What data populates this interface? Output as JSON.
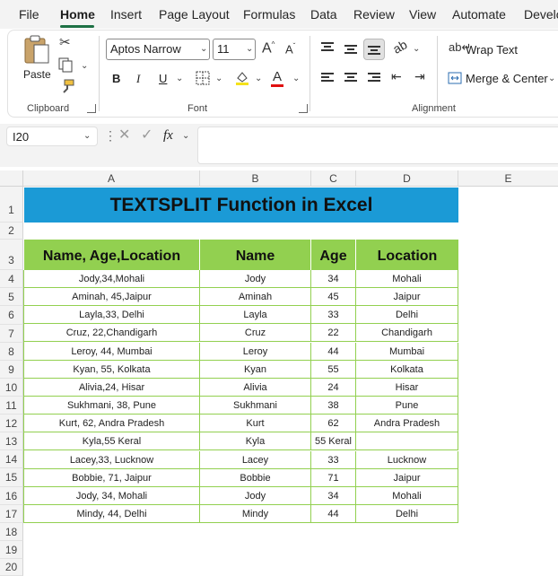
{
  "tabs": [
    "File",
    "Home",
    "Insert",
    "Page Layout",
    "Formulas",
    "Data",
    "Review",
    "View",
    "Automate",
    "Develo"
  ],
  "ribbon": {
    "clipboard": {
      "paste_label": "Paste",
      "group_label": "Clipboard"
    },
    "font": {
      "font_name": "Aptos Narrow",
      "font_size": "11",
      "bold": "B",
      "italic": "I",
      "underline": "U",
      "group_label": "Font"
    },
    "alignment": {
      "wrap_text": "Wrap Text",
      "merge_center": "Merge & Center",
      "group_label": "Alignment"
    }
  },
  "formula_bar": {
    "name_box": "I20",
    "fx": "fx",
    "content": ""
  },
  "columns": [
    "A",
    "B",
    "C",
    "D",
    "E"
  ],
  "rows": [
    "1",
    "2",
    "3",
    "4",
    "5",
    "6",
    "7",
    "8",
    "9",
    "10",
    "11",
    "12",
    "13",
    "14",
    "15",
    "16",
    "17",
    "18",
    "19",
    "20"
  ],
  "sheet": {
    "title": "TEXTSPLIT Function in Excel",
    "headers": [
      "Name, Age,Location",
      "Name",
      "Age",
      "Location"
    ],
    "data": [
      [
        "Jody,34,Mohali",
        "Jody",
        "34",
        "Mohali"
      ],
      [
        "Aminah, 45,Jaipur",
        "Aminah",
        "45",
        "Jaipur"
      ],
      [
        "Layla,33, Delhi",
        "Layla",
        "33",
        "Delhi"
      ],
      [
        "Cruz, 22,Chandigarh",
        "Cruz",
        "22",
        "Chandigarh"
      ],
      [
        "Leroy, 44, Mumbai",
        "Leroy",
        "44",
        "Mumbai"
      ],
      [
        "Kyan, 55, Kolkata",
        "Kyan",
        "55",
        "Kolkata"
      ],
      [
        "Alivia,24, Hisar",
        "Alivia",
        "24",
        "Hisar"
      ],
      [
        "Sukhmani, 38, Pune",
        "Sukhmani",
        "38",
        "Pune"
      ],
      [
        "Kurt, 62, Andra Pradesh",
        "Kurt",
        "62",
        "Andra Pradesh"
      ],
      [
        "Kyla,55 Keral",
        "Kyla",
        "55 Keral",
        ""
      ],
      [
        "Lacey,33, Lucknow",
        "Lacey",
        "33",
        "Lucknow"
      ],
      [
        "Bobbie, 71, Jaipur",
        "Bobbie",
        "71",
        "Jaipur"
      ],
      [
        "Jody, 34, Mohali",
        "Jody",
        "34",
        "Mohali"
      ],
      [
        "Mindy, 44, Delhi",
        "Mindy",
        "44",
        "Delhi"
      ]
    ]
  },
  "colors": {
    "title_fill": "#1b9ad6",
    "header_fill": "#92d050",
    "border": "#92d050",
    "accent": "#1e7145"
  }
}
